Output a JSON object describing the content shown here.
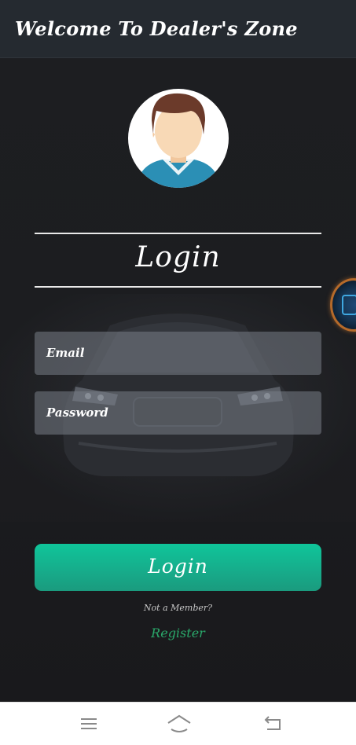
{
  "app_bar": {
    "title": "Welcome To Dealer's Zone"
  },
  "avatar": {
    "icon": "user-avatar-icon"
  },
  "login_form": {
    "heading": "Login",
    "email_placeholder": "Email",
    "password_placeholder": "Password",
    "submit_label": "Login",
    "not_member_text": "Not a Member?",
    "register_label": "Register"
  },
  "floating_widget": {
    "icon": "assistant-bubble-icon"
  },
  "nav_bar": {
    "items": [
      {
        "icon": "menu-icon"
      },
      {
        "icon": "home-icon"
      },
      {
        "icon": "back-icon"
      }
    ]
  },
  "colors": {
    "app_bar_bg": "#252a30",
    "screen_bg": "#1b1c1f",
    "accent": "#17ab8a",
    "register": "#2aa86a",
    "field_bg": "#787d86"
  }
}
